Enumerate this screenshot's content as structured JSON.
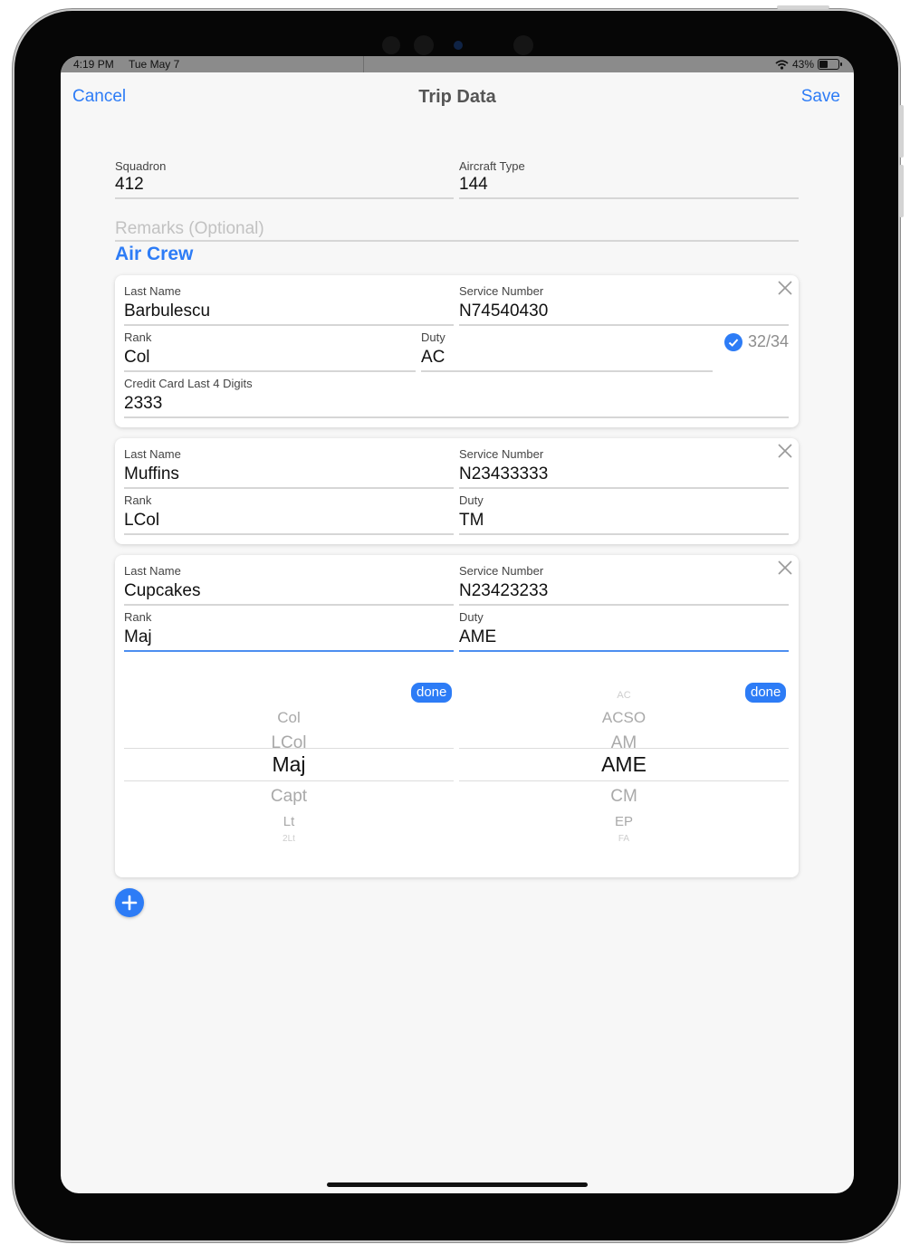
{
  "status_bar": {
    "time": "4:19 PM",
    "date": "Tue May 7",
    "battery": "43%",
    "battery_level": 0.43
  },
  "nav": {
    "cancel": "Cancel",
    "title": "Trip Data",
    "save": "Save"
  },
  "trip": {
    "squadron": {
      "label": "Squadron",
      "value": "412"
    },
    "aircraft_type": {
      "label": "Aircraft Type",
      "value": "144"
    },
    "remarks_placeholder": "Remarks (Optional)"
  },
  "air_crew": {
    "title": "Air Crew",
    "members": [
      {
        "last_name": {
          "label": "Last Name",
          "value": "Barbulescu"
        },
        "service_number": {
          "label": "Service Number",
          "value": "N74540430"
        },
        "rank": {
          "label": "Rank",
          "value": "Col"
        },
        "duty": {
          "label": "Duty",
          "value": "AC"
        },
        "counter": "32/34",
        "credit_card": {
          "label": "Credit Card Last 4 Digits",
          "value": "2333"
        }
      },
      {
        "last_name": {
          "label": "Last Name",
          "value": "Muffins"
        },
        "service_number": {
          "label": "Service Number",
          "value": "N23433333"
        },
        "rank": {
          "label": "Rank",
          "value": "LCol"
        },
        "duty": {
          "label": "Duty",
          "value": "TM"
        }
      },
      {
        "last_name": {
          "label": "Last Name",
          "value": "Cupcakes"
        },
        "service_number": {
          "label": "Service Number",
          "value": "N23423233"
        },
        "rank": {
          "label": "Rank",
          "value": "Maj"
        },
        "duty": {
          "label": "Duty",
          "value": "AME"
        },
        "done_label": "done"
      }
    ]
  },
  "rank_picker": {
    "above": [
      "Col",
      "LCol"
    ],
    "selected": "Maj",
    "below": [
      "Capt",
      "Lt",
      "2Lt"
    ]
  },
  "duty_picker": {
    "above": [
      "AC",
      "ACSO",
      "AM"
    ],
    "selected": "AME",
    "below": [
      "CM",
      "EP",
      "FA"
    ]
  },
  "colors": {
    "accent": "#2d7cf6",
    "background": "#f7f7f7",
    "card": "#ffffff",
    "muted": "#a9a9a9"
  },
  "icons": {
    "wifi": "wifi-icon",
    "battery": "battery-icon",
    "close": "close-icon",
    "check": "checkmark-circle-icon",
    "add": "plus-circle-icon"
  }
}
